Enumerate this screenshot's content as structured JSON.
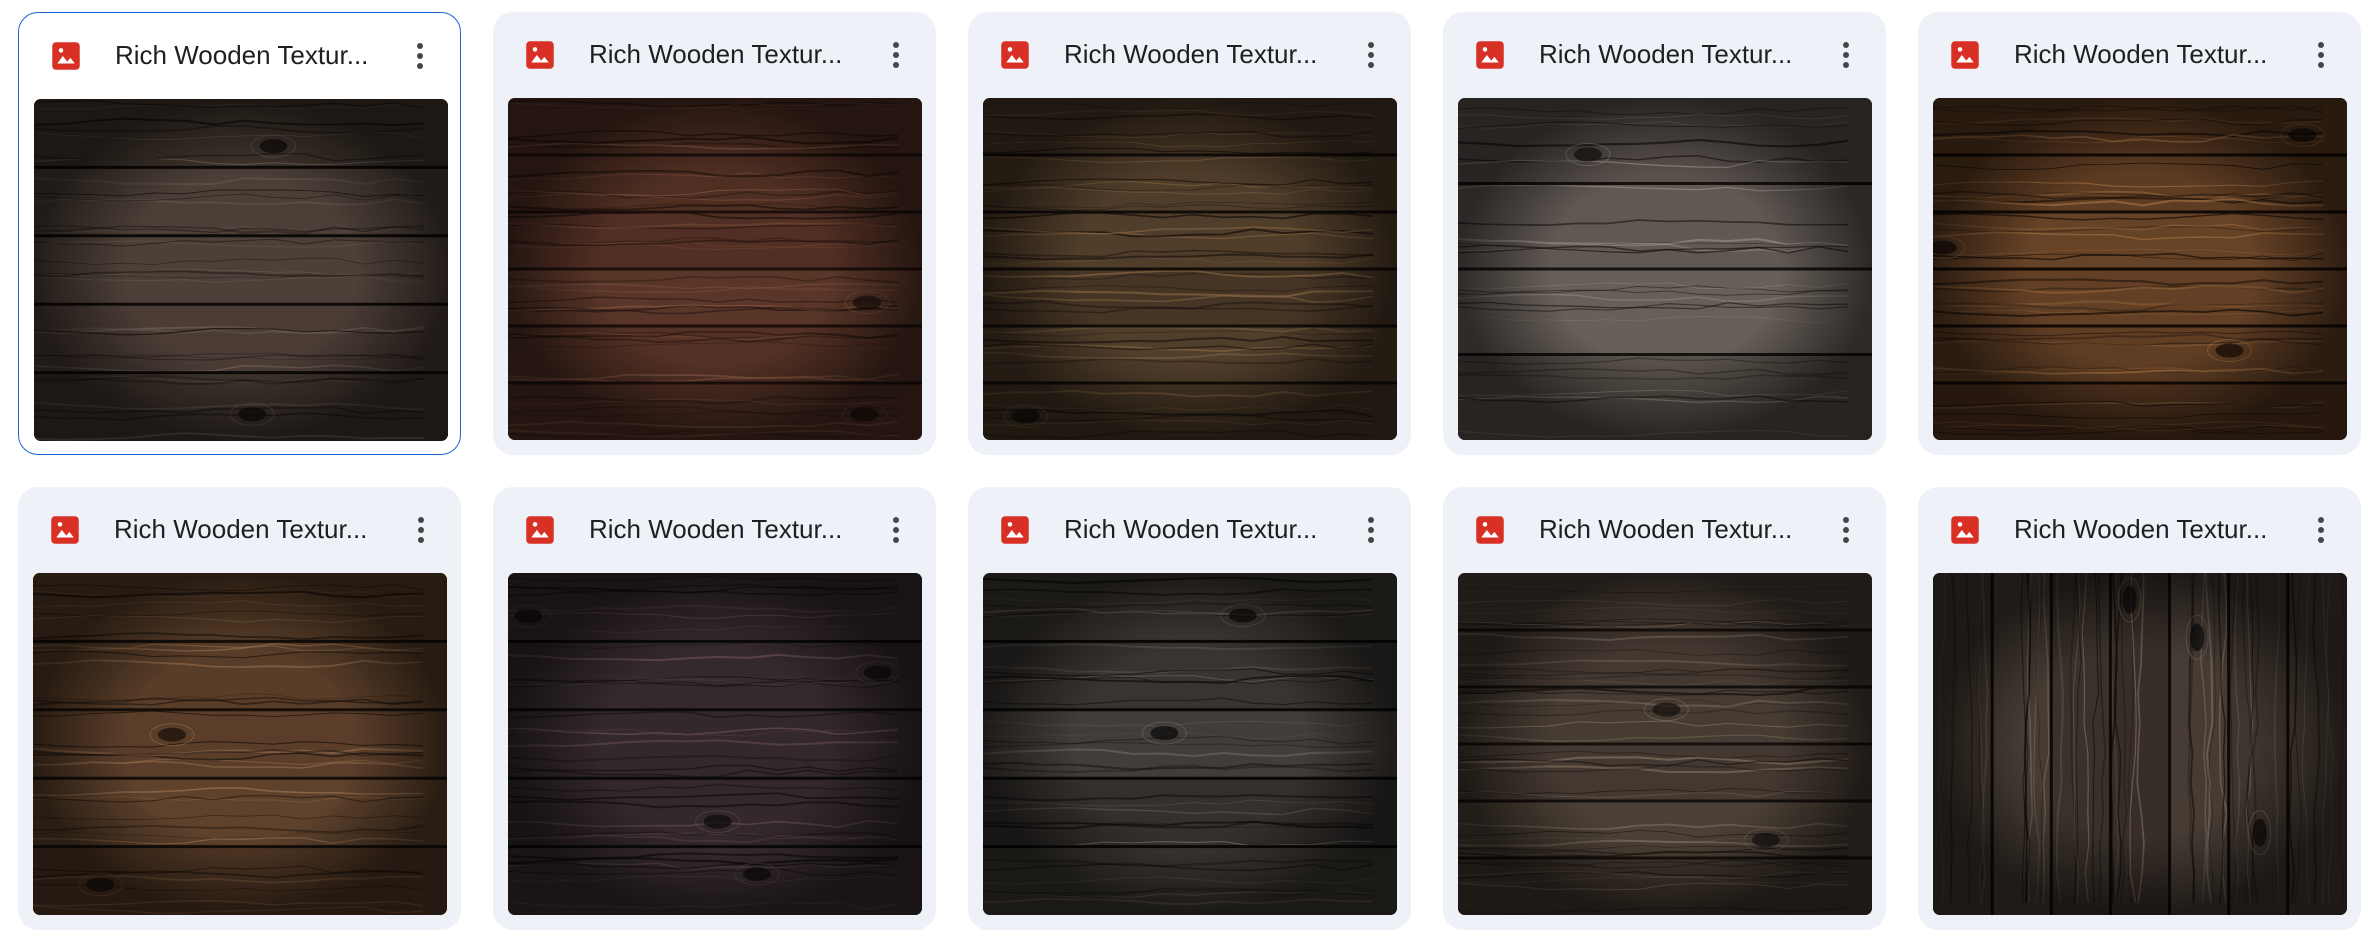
{
  "files": [
    {
      "title": "Rich Wooden Textur...",
      "icon": "image-file-icon",
      "selected": true,
      "wood": {
        "dir": "h",
        "count": 5,
        "base": "#3a2f29",
        "grain": "#7a6a5d",
        "shade": "#0d0a08"
      }
    },
    {
      "title": "Rich Wooden Textur...",
      "icon": "image-file-icon",
      "selected": false,
      "wood": {
        "dir": "h",
        "count": 6,
        "base": "#4a2a20",
        "grain": "#8a5a44",
        "shade": "#1d0f0b"
      }
    },
    {
      "title": "Rich Wooden Textur...",
      "icon": "image-file-icon",
      "selected": false,
      "wood": {
        "dir": "h",
        "count": 6,
        "base": "#3d2e22",
        "grain": "#8c6b45",
        "shade": "#120d09"
      }
    },
    {
      "title": "Rich Wooden Textur...",
      "icon": "image-file-icon",
      "selected": false,
      "wood": {
        "dir": "h",
        "count": 4,
        "base": "#4c4540",
        "grain": "#a89f96",
        "shade": "#151210"
      }
    },
    {
      "title": "Rich Wooden Textur...",
      "icon": "image-file-icon",
      "selected": false,
      "wood": {
        "dir": "h",
        "count": 6,
        "base": "#4a2d1a",
        "grain": "#b07a48",
        "shade": "#120a06"
      }
    },
    {
      "title": "Rich Wooden Textur...",
      "icon": "image-file-icon",
      "selected": false,
      "wood": {
        "dir": "h",
        "count": 5,
        "base": "#4a3120",
        "grain": "#9b7350",
        "shade": "#150e09"
      }
    },
    {
      "title": "Rich Wooden Textur...",
      "icon": "image-file-icon",
      "selected": false,
      "wood": {
        "dir": "h",
        "count": 5,
        "base": "#2a2226",
        "grain": "#6a5058",
        "shade": "#0b090a"
      }
    },
    {
      "title": "Rich Wooden Textur...",
      "icon": "image-file-icon",
      "selected": false,
      "wood": {
        "dir": "h",
        "count": 5,
        "base": "#2e2a27",
        "grain": "#7a726a",
        "shade": "#0a0908"
      }
    },
    {
      "title": "Rich Wooden Textur...",
      "icon": "image-file-icon",
      "selected": false,
      "wood": {
        "dir": "h",
        "count": 6,
        "base": "#3b312a",
        "grain": "#857462",
        "shade": "#14100d"
      }
    },
    {
      "title": "Rich Wooden Textur...",
      "icon": "image-file-icon",
      "selected": false,
      "wood": {
        "dir": "v",
        "count": 7,
        "base": "#2b241f",
        "grain": "#8a7766",
        "shade": "#0c0a09"
      }
    }
  ],
  "colors": {
    "accent": "#1a66d2",
    "card_bg": "#eef2f8",
    "icon_red": "#d93025"
  }
}
